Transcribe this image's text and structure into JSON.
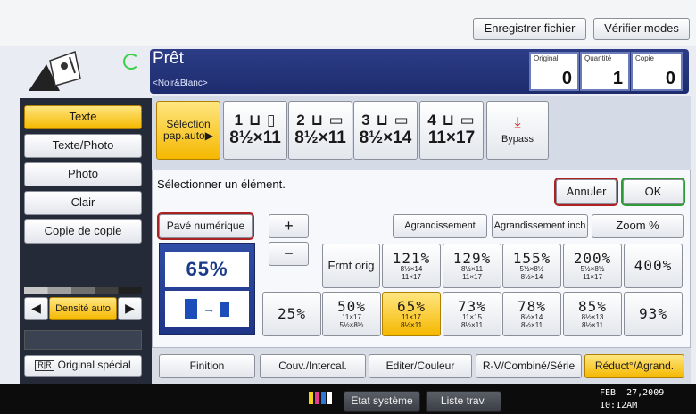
{
  "header": {
    "save_file_label": "Enregistrer fichier",
    "check_modes_label": "Vérifier modes"
  },
  "status": {
    "title": "Prêt",
    "subtitle": "<Noir&Blanc>",
    "counters": [
      {
        "label": "Original",
        "value": "0"
      },
      {
        "label": "Quantité",
        "value": "1"
      },
      {
        "label": "Copie",
        "value": "0"
      }
    ]
  },
  "original_type": {
    "items": [
      {
        "label": "Texte",
        "selected": true
      },
      {
        "label": "Texte/Photo",
        "selected": false
      },
      {
        "label": "Photo",
        "selected": false
      },
      {
        "label": "Clair",
        "selected": false
      },
      {
        "label": "Copie de copie",
        "selected": false
      }
    ]
  },
  "density": {
    "left_arrow": "◀",
    "label": "Densité auto",
    "right_arrow": "▶"
  },
  "special_original": {
    "label": "Original spécial"
  },
  "paper": {
    "auto_label_line1": "Sélection",
    "auto_label_line2": "pap.auto▶",
    "trays": [
      {
        "number": "1",
        "size": "8½×11"
      },
      {
        "number": "2",
        "size": "8½×11"
      },
      {
        "number": "3",
        "size": "8½×14"
      },
      {
        "number": "4",
        "size": "11×17"
      }
    ],
    "bypass_label": "Bypass"
  },
  "reduce_panel": {
    "prompt": "Sélectionner un élément.",
    "cancel_label": "Annuler",
    "ok_label": "OK",
    "keypad_label": "Pavé numérique",
    "plus_label": "+",
    "minus_label": "−",
    "enlarge_label": "Agrandissement",
    "enlarge_inch_label": "Agrandissement inch",
    "zoom_label": "Zoom %",
    "current_ratio": "65%",
    "full_size_label": "Frmt orig",
    "ratios": [
      {
        "value": "121%",
        "line1": "8½×14",
        "line2": "11×17",
        "selected": false
      },
      {
        "value": "129%",
        "line1": "8½×11",
        "line2": "11×17",
        "selected": false
      },
      {
        "value": "155%",
        "line1": "5½×8½",
        "line2": "8½×14",
        "selected": false
      },
      {
        "value": "200%",
        "line1": "5½×8½",
        "line2": "11×17",
        "selected": false
      },
      {
        "value": "400%",
        "line1": "",
        "line2": "",
        "selected": false
      },
      {
        "value": "25%",
        "line1": "",
        "line2": "",
        "selected": false
      },
      {
        "value": "50%",
        "line1": "11×17",
        "line2": "5½×8½",
        "selected": false
      },
      {
        "value": "65%",
        "line1": "11×17",
        "line2": "8½×11",
        "selected": true
      },
      {
        "value": "73%",
        "line1": "11×15",
        "line2": "8½×11",
        "selected": false
      },
      {
        "value": "78%",
        "line1": "8½×14",
        "line2": "8½×11",
        "selected": false
      },
      {
        "value": "85%",
        "line1": "8½×13",
        "line2": "8½×11",
        "selected": false
      },
      {
        "value": "93%",
        "line1": "",
        "line2": "",
        "selected": false
      }
    ]
  },
  "tabs": [
    {
      "label": "Finition",
      "active": false
    },
    {
      "label": "Couv./Intercal.",
      "active": false
    },
    {
      "label": "Editer/Couleur",
      "active": false
    },
    {
      "label": "R-V/Combiné/Série",
      "active": false
    },
    {
      "label": "Réduct°/Agrand.",
      "active": true
    }
  ],
  "footer": {
    "system_status_label": "Etat système",
    "job_list_label": "Liste trav.",
    "date": "FEB  27,2009",
    "time": "10:12AM"
  },
  "colors": {
    "selected": "#f5b800",
    "status_bar": "#1e2c6e",
    "ratio_text": "#1c3a8a",
    "ok_outline": "#2e9a3a",
    "cancel_outline": "#b02020"
  },
  "icons": {
    "ready": "ready-ring-icon",
    "bypass": "bypass-tray-icon",
    "special": "special-original-icon",
    "kyc": "kyc-toner-icon"
  }
}
